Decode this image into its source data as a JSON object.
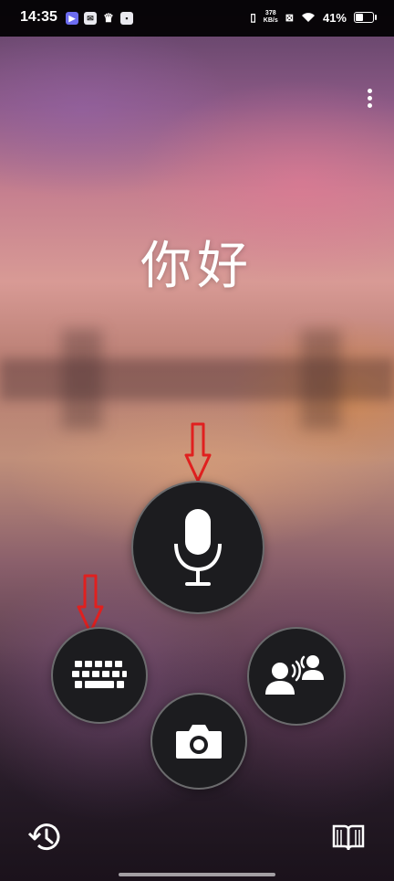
{
  "status_bar": {
    "time": "14:35",
    "network_speed_value": "378",
    "network_speed_unit": "KB/s",
    "battery": "41%",
    "notification_icons": [
      "media-play-icon",
      "mail-icon",
      "crown-icon",
      "app-icon"
    ]
  },
  "greeting": "你好",
  "buttons": {
    "menu": "more-options",
    "microphone": "microphone",
    "keyboard": "keyboard",
    "camera": "camera",
    "conversation": "conversation",
    "history": "history",
    "phrasebook": "phrasebook"
  },
  "annotations": {
    "arrow_color": "#e0201f",
    "arrows": [
      "arrow-to-microphone",
      "arrow-to-keyboard"
    ]
  }
}
